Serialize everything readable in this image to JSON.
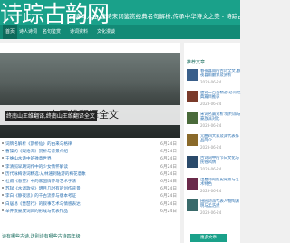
{
  "header": {
    "logo": "诗踪古韵网",
    "slogan": "古诗词大全,唐诗宋词鉴赏经典名句解析,传承中华诗文之美 - 诗踪古韵网"
  },
  "nav": {
    "items": [
      "首页",
      "诗人诗词",
      "名句鉴赏",
      "诗词资料",
      "文化漫谈"
    ],
    "active_index": 0
  },
  "main": {
    "breadcrumb": "",
    "banner": {
      "small_caption": "终南山王维翻译,终南山王维翻译全文",
      "large_caption": "山王维翻译全文"
    },
    "list": [
      {
        "title": "词牌名解析《鹊桥仙》的由来与格律",
        "date": "6月24日"
      },
      {
        "title": "曹操的《观沧海》赏析与背景介绍",
        "date": "6月24日"
      },
      {
        "title": "王维山水诗中的禅意世界",
        "date": "6月24日"
      },
      {
        "title": "李清照早期词作中的少女情怀解读",
        "date": "6月24日"
      },
      {
        "title": "历代咏梅诗词精选:从林逋到陆游的梅花意象",
        "date": "6月24日"
      },
      {
        "title": "杜甫《春望》中的家国情怀与艺术手法",
        "date": "6月24日"
      },
      {
        "title": "苏轼《水调歌头》明月几时有的创作背景",
        "date": "6月24日"
      },
      {
        "title": "李白《静夜思》的千古流传与版本考证",
        "date": "6月24日"
      },
      {
        "title": "白居易《琵琶行》的叙事艺术与情感表达",
        "date": "6月24日"
      },
      {
        "title": "辛弃疾豪放词风的形成与代表作品",
        "date": "6月24日"
      }
    ],
    "section_title": "诗有哪些古诗,送别诗有哪些古诗四年级"
  },
  "sidebar": {
    "title": "推荐文章",
    "cards": [
      {
        "title": "春夜喜雨的古诗全文,春夜喜雨翻译及赏析",
        "date": "2023-06-24",
        "color": "#3a5f8a"
      },
      {
        "title": "唐诗三百首精选:必背经典篇目推荐",
        "date": "2023-06-24",
        "color": "#7a3a2a"
      },
      {
        "title": "宋词名篇赏析:婉约派与豪放派对比",
        "date": "2023-06-24",
        "color": "#4a6a3a"
      },
      {
        "title": "元曲四大家及其代表作品简介",
        "date": "2023-06-24",
        "color": "#8a6a2a"
      },
      {
        "title": "古诗词中的节日文化与民俗风情",
        "date": "2023-06-24",
        "color": "#2a4a6a"
      },
      {
        "title": "边塞诗的历史背景与艺术特色",
        "date": "2023-06-24",
        "color": "#6a2a4a"
      },
      {
        "title": "田园诗派代表人物陶渊明与孟浩然",
        "date": "2023-06-24",
        "color": "#3a6a6a"
      }
    ],
    "more_label": "更多文章"
  }
}
